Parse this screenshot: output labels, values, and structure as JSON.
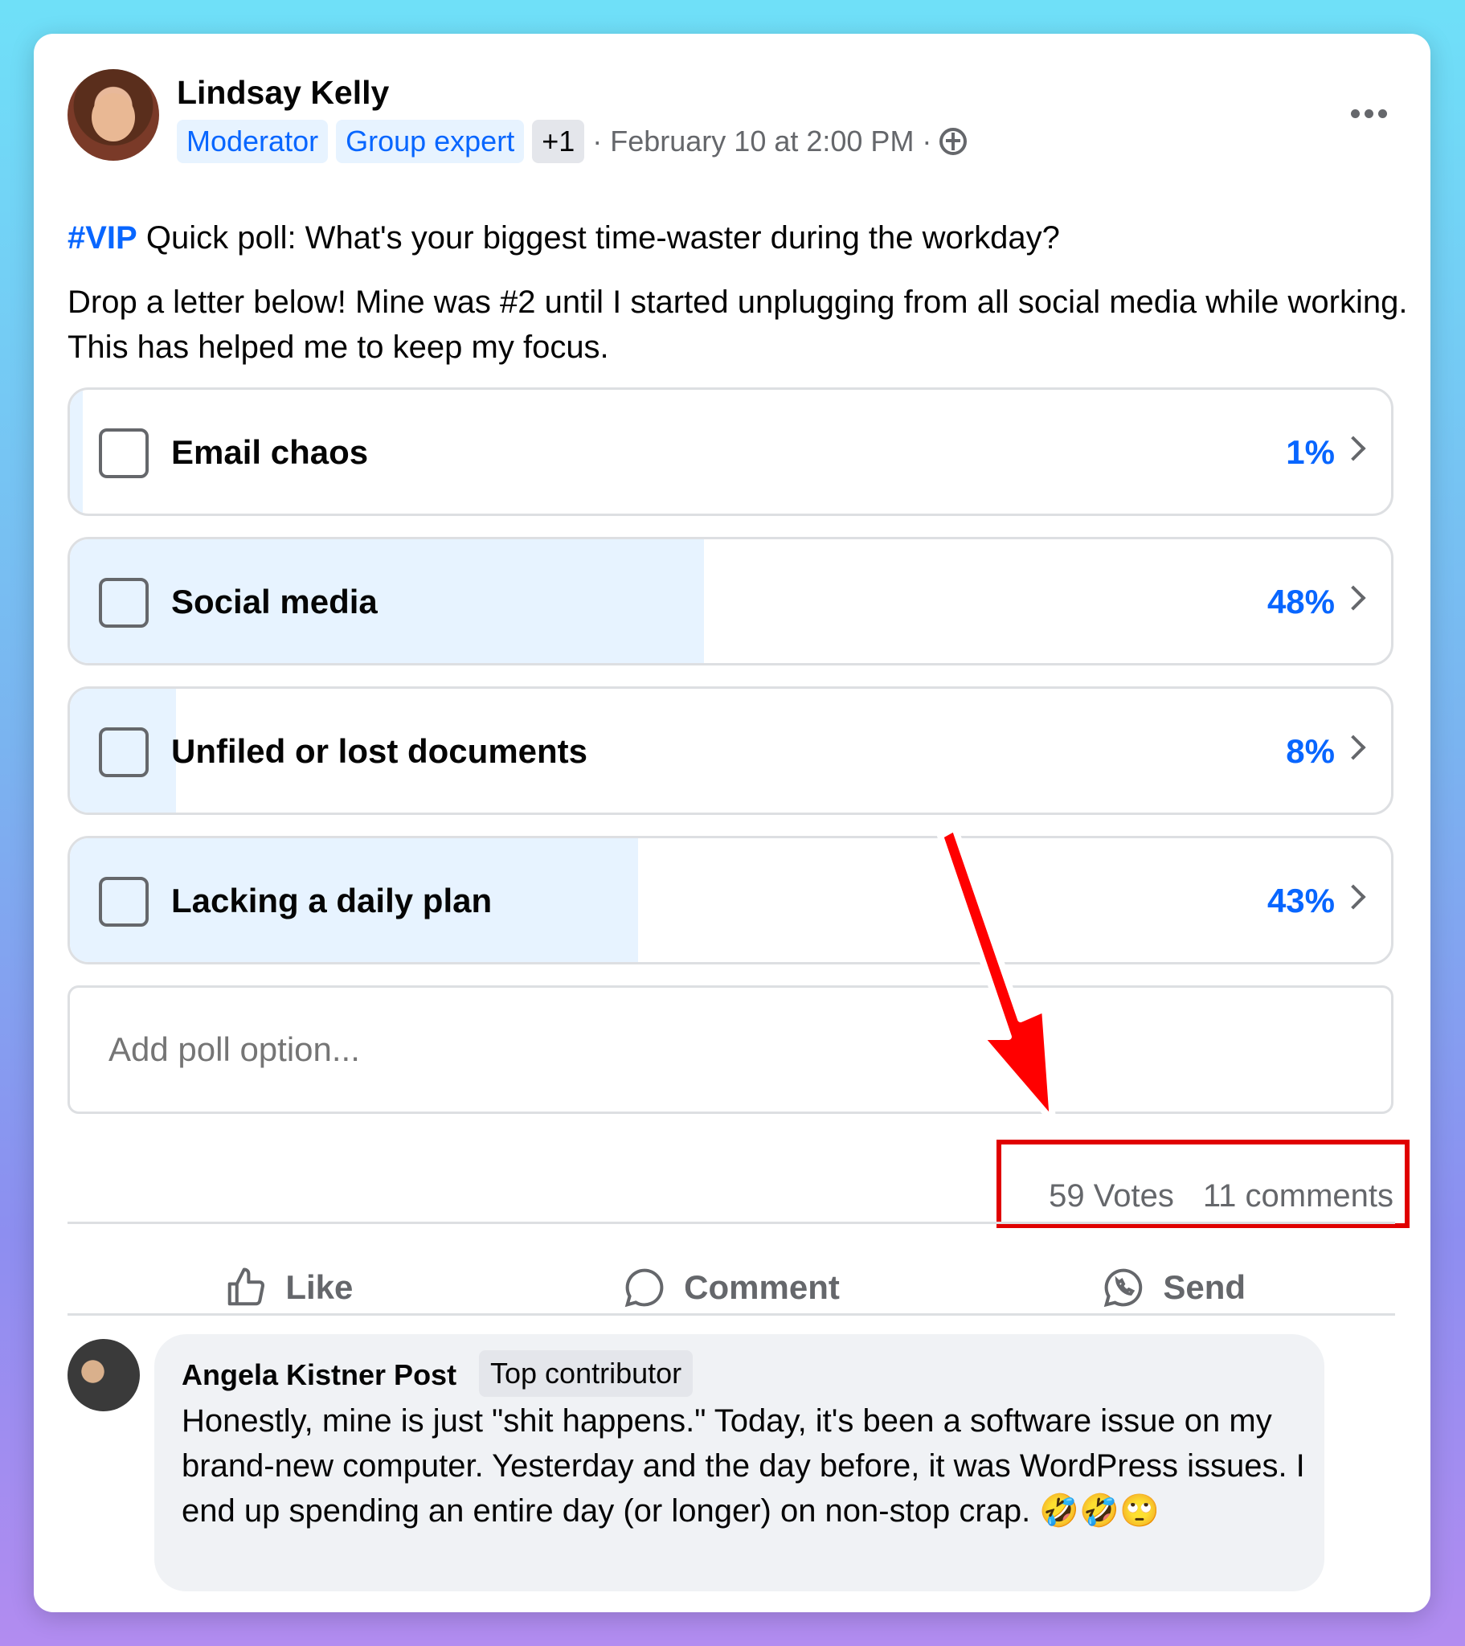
{
  "post": {
    "author": "Lindsay Kelly",
    "badges": [
      "Moderator",
      "Group expert"
    ],
    "extra_badges": "+1",
    "timestamp": "· February 10 at 2:00 PM ·",
    "tag": "#VIP",
    "line1": " Quick poll: What's your biggest time-waster during the workday?",
    "line2": "Drop a letter below! Mine was #2 until I started unplugging from all social media while working. This has helped me to keep my focus."
  },
  "poll": {
    "options": [
      {
        "label": "Email chaos",
        "percent": "1%",
        "fill": 0.01
      },
      {
        "label": "Social media",
        "percent": "48%",
        "fill": 0.48
      },
      {
        "label": "Unfiled or lost documents",
        "percent": "8%",
        "fill": 0.08
      },
      {
        "label": "Lacking a daily plan",
        "percent": "43%",
        "fill": 0.43
      }
    ],
    "add_placeholder": "Add poll option..."
  },
  "stats": {
    "votes": "59 Votes",
    "comments": "11 comments"
  },
  "actions": {
    "like": "Like",
    "comment": "Comment",
    "send": "Send"
  },
  "comment": {
    "author": "Angela Kistner Post",
    "badge": "Top contributor",
    "text": "Honestly, mine is just \"shit happens.\" Today, it's been a software issue on my brand-new computer. Yesterday and the day before, it was WordPress issues. I end up spending an entire day (or longer) on non-stop crap. 🤣🤣🙄"
  },
  "colors": {
    "accent": "#0866ff",
    "highlight": "#e00000",
    "fill": "#e7f3ff"
  }
}
